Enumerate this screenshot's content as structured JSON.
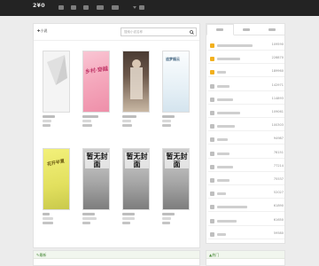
{
  "header": {
    "logo": "2¥0",
    "nav_items": [
      {
        "id": "nav-1",
        "w": 6
      },
      {
        "id": "nav-2",
        "w": 6
      },
      {
        "id": "nav-3",
        "w": 6
      },
      {
        "id": "nav-4",
        "w": 8
      },
      {
        "id": "nav-5",
        "w": 8
      },
      {
        "id": "nav-6",
        "w": 6
      }
    ]
  },
  "main": {
    "title": "✚小说",
    "search_placeholder": "搜索小说名称",
    "search_icon": "search-icon",
    "books": [
      {
        "cover": "blank",
        "title_w": 14,
        "author_w": 10,
        "meta_w": 9
      },
      {
        "cover": "pink",
        "title_w": 18,
        "author_w": 10,
        "meta_w": 11,
        "cover_text": "乡村·穿越"
      },
      {
        "cover": "dark",
        "title_w": 16,
        "author_w": 10,
        "meta_w": 11
      },
      {
        "cover": "light",
        "title_w": 14,
        "author_w": 10,
        "meta_w": 10,
        "cover_text": "追梦烟云"
      },
      {
        "cover": "yellow",
        "title_w": 8,
        "author_w": 12,
        "meta_w": 12,
        "cover_text": "花开半夏"
      },
      {
        "cover": "nocover",
        "title_w": 14,
        "author_w": 16,
        "meta_w": 9,
        "cover_text": "暂无封面"
      },
      {
        "cover": "nocover",
        "title_w": 14,
        "author_w": 14,
        "meta_w": 9,
        "cover_text": "暂无封面"
      },
      {
        "cover": "nocover",
        "title_w": 14,
        "author_w": 10,
        "meta_w": 9,
        "cover_text": "暂无封面"
      }
    ]
  },
  "sidebar": {
    "tabs": [
      "排行",
      "人气",
      "收藏"
    ],
    "ranks": [
      {
        "num": "1",
        "color": "#f2b01e",
        "name_w": 40,
        "count": "109590"
      },
      {
        "num": "2",
        "color": "#f2b01e",
        "name_w": 26,
        "count": "228870"
      },
      {
        "num": "3",
        "color": "#f2b01e",
        "name_w": 10,
        "count": "189960"
      },
      {
        "num": "4",
        "color": "#bfbfbf",
        "name_w": 14,
        "count": "142971"
      },
      {
        "num": "5",
        "color": "#bfbfbf",
        "name_w": 18,
        "count": "114893"
      },
      {
        "num": "6",
        "color": "#bfbfbf",
        "name_w": 26,
        "count": "109061"
      },
      {
        "num": "7",
        "color": "#bfbfbf",
        "name_w": 20,
        "count": "100303"
      },
      {
        "num": "8",
        "color": "#bfbfbf",
        "name_w": 12,
        "count": "94987"
      },
      {
        "num": "9",
        "color": "#bfbfbf",
        "name_w": 14,
        "count": "78151"
      },
      {
        "num": "10",
        "color": "#bfbfbf",
        "name_w": 18,
        "count": "77214"
      },
      {
        "num": "11",
        "color": "#bfbfbf",
        "name_w": 14,
        "count": "75537"
      },
      {
        "num": "12",
        "color": "#bfbfbf",
        "name_w": 10,
        "count": "52027"
      },
      {
        "num": "13",
        "color": "#bfbfbf",
        "name_w": 34,
        "count": "61890"
      },
      {
        "num": "14",
        "color": "#bfbfbf",
        "name_w": 22,
        "count": "61650"
      },
      {
        "num": "15",
        "color": "#bfbfbf",
        "name_w": 10,
        "count": "59580"
      }
    ]
  },
  "panels": {
    "left_title": "✎最新",
    "right_title": "▲热门"
  }
}
